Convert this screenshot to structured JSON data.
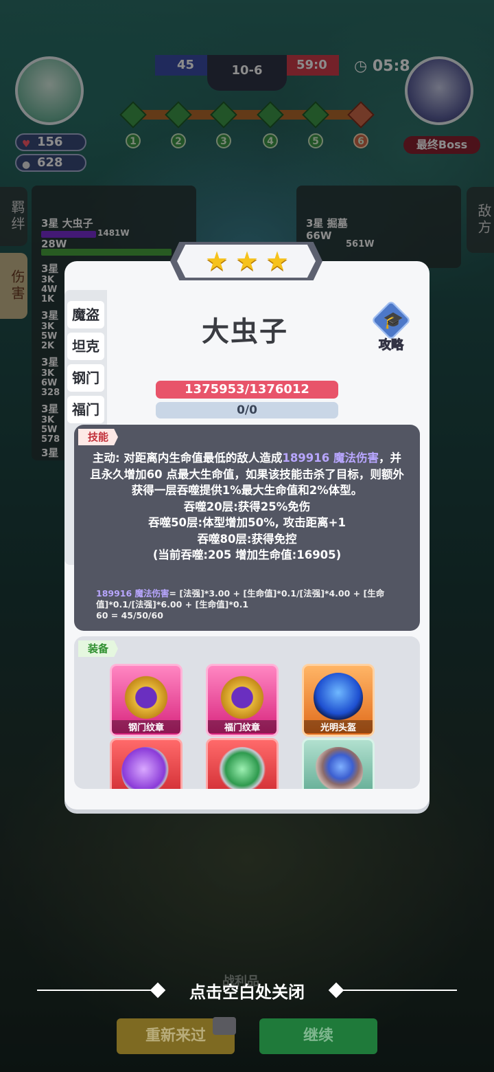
{
  "hud": {
    "player_hp": "156",
    "player_coins": "628",
    "score_blue": "45",
    "round": "10-6",
    "score_red": "59:0",
    "timer": "05:8",
    "boss_label": "最终Boss",
    "stages": [
      "1",
      "2",
      "3",
      "4",
      "5",
      "6"
    ]
  },
  "side_tabs": {
    "bond": "羁绊",
    "damage": "伤害",
    "enemy": "敌方"
  },
  "damage_panel": {
    "left_name": "3星 大虫子",
    "left_value1": "1481W",
    "left_value2": "28W",
    "right_name": "3星 掘墓",
    "right_value1": "66W",
    "right_value2": "561W",
    "rows": [
      {
        "name": "3星",
        "v1": "3K",
        "v2": "4W",
        "v3": "1K"
      },
      {
        "name": "3星",
        "v1": "3K",
        "v2": "5W",
        "v3": "2K"
      },
      {
        "name": "3星",
        "v1": "3K",
        "v2": "6W",
        "v3": "328"
      },
      {
        "name": "3星",
        "v1": "3K",
        "v2": "5W",
        "v3": "578"
      },
      {
        "name": "3星",
        "v1": "",
        "v2": "",
        "v3": ""
      }
    ]
  },
  "modal": {
    "stars": 3,
    "hero_name": "大虫子",
    "guide_label": "攻略",
    "class_tabs": [
      "魔盗",
      "坦克",
      "钢门",
      "福门"
    ],
    "hp_text": "1375953/1376012",
    "mana_text": "0/0",
    "skill_tag": "技能",
    "skill_line1_a": "主动: 对距离内生命值最低的敌人造成",
    "skill_line1_b": "189916 魔法伤害",
    "skill_line1_c": "，并且永久增加60 点最大生命值，如果该技能击杀了目标，则额外获得一层吞噬提供1%最大生命值和2%体型。",
    "skill_line2": "吞噬20层:获得25%免伤",
    "skill_line3": "吞噬50层:体型增加50%, 攻击距离+1",
    "skill_line4": "吞噬80层:获得免控",
    "skill_line5": "(当前吞噬:205 增加生命值:16905)",
    "formula_a": "189916 魔法伤害",
    "formula_b": "= [法强]*3.00 + [生命值]*0.1/[法强]*4.00 + [生命值]*0.1/[法强]*6.00 + [生命值]*0.1",
    "formula_c": "60 = 45/50/60",
    "equip_tag": "装备",
    "items": [
      {
        "name": "钢门纹章",
        "color": "pink",
        "icon": "shield-crest-icon"
      },
      {
        "name": "福门纹章",
        "color": "pink",
        "icon": "shield-crest-icon"
      },
      {
        "name": "光明头盔",
        "color": "orange",
        "icon": "helmet-icon"
      },
      {
        "name": "",
        "color": "red",
        "icon": "heart-gem-icon"
      },
      {
        "name": "",
        "color": "red",
        "icon": "green-armor-icon"
      },
      {
        "name": "",
        "color": "teal",
        "icon": "spellbook-icon"
      }
    ]
  },
  "footer": {
    "close_hint": "点击空白处关闭",
    "loot_label": "战利品",
    "retry_label": "重新来过",
    "continue_label": "继续"
  },
  "colors": {
    "hp_bar": "#e8546a",
    "mana_bar": "#c9d6e6",
    "skill_box": "#535663",
    "star": "#f6c21c"
  }
}
